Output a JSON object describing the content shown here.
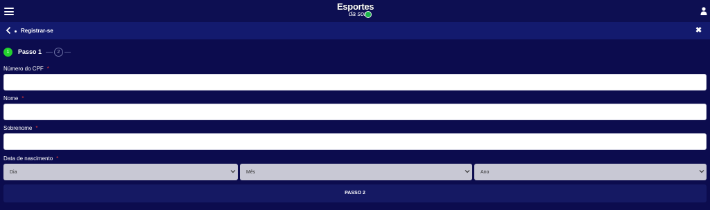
{
  "header": {
    "menu_icon": "hamburger-icon",
    "logo_top": "Esportes",
    "logo_bottom": "da sorte",
    "user_icon": "user-icon"
  },
  "subheader": {
    "back_icon": "chevron-left-icon",
    "title": "Registrar-se",
    "close_icon": "close-icon",
    "close_glyph": "✖"
  },
  "steps": [
    {
      "number": "1",
      "label": "Passo 1",
      "active": true
    },
    {
      "number": "2",
      "label": "",
      "active": false
    }
  ],
  "form": {
    "cpf": {
      "label": "Número do CPF",
      "required_mark": "*",
      "value": ""
    },
    "nome": {
      "label": "Nome",
      "required_mark": "*",
      "value": ""
    },
    "sobrenome": {
      "label": "Sobrenome",
      "required_mark": "*",
      "value": ""
    },
    "birthdate": {
      "label": "Data de nascimento",
      "required_mark": "*",
      "day": "Dia",
      "month": "Mês",
      "year": "Ano"
    },
    "submit_label": "PASSO 2"
  },
  "colors": {
    "background": "#0c0c4e",
    "topbar": "#0d0f52",
    "subbar": "#131a6e",
    "step_active": "#23d12d",
    "required": "#e53935",
    "button": "#151963"
  }
}
